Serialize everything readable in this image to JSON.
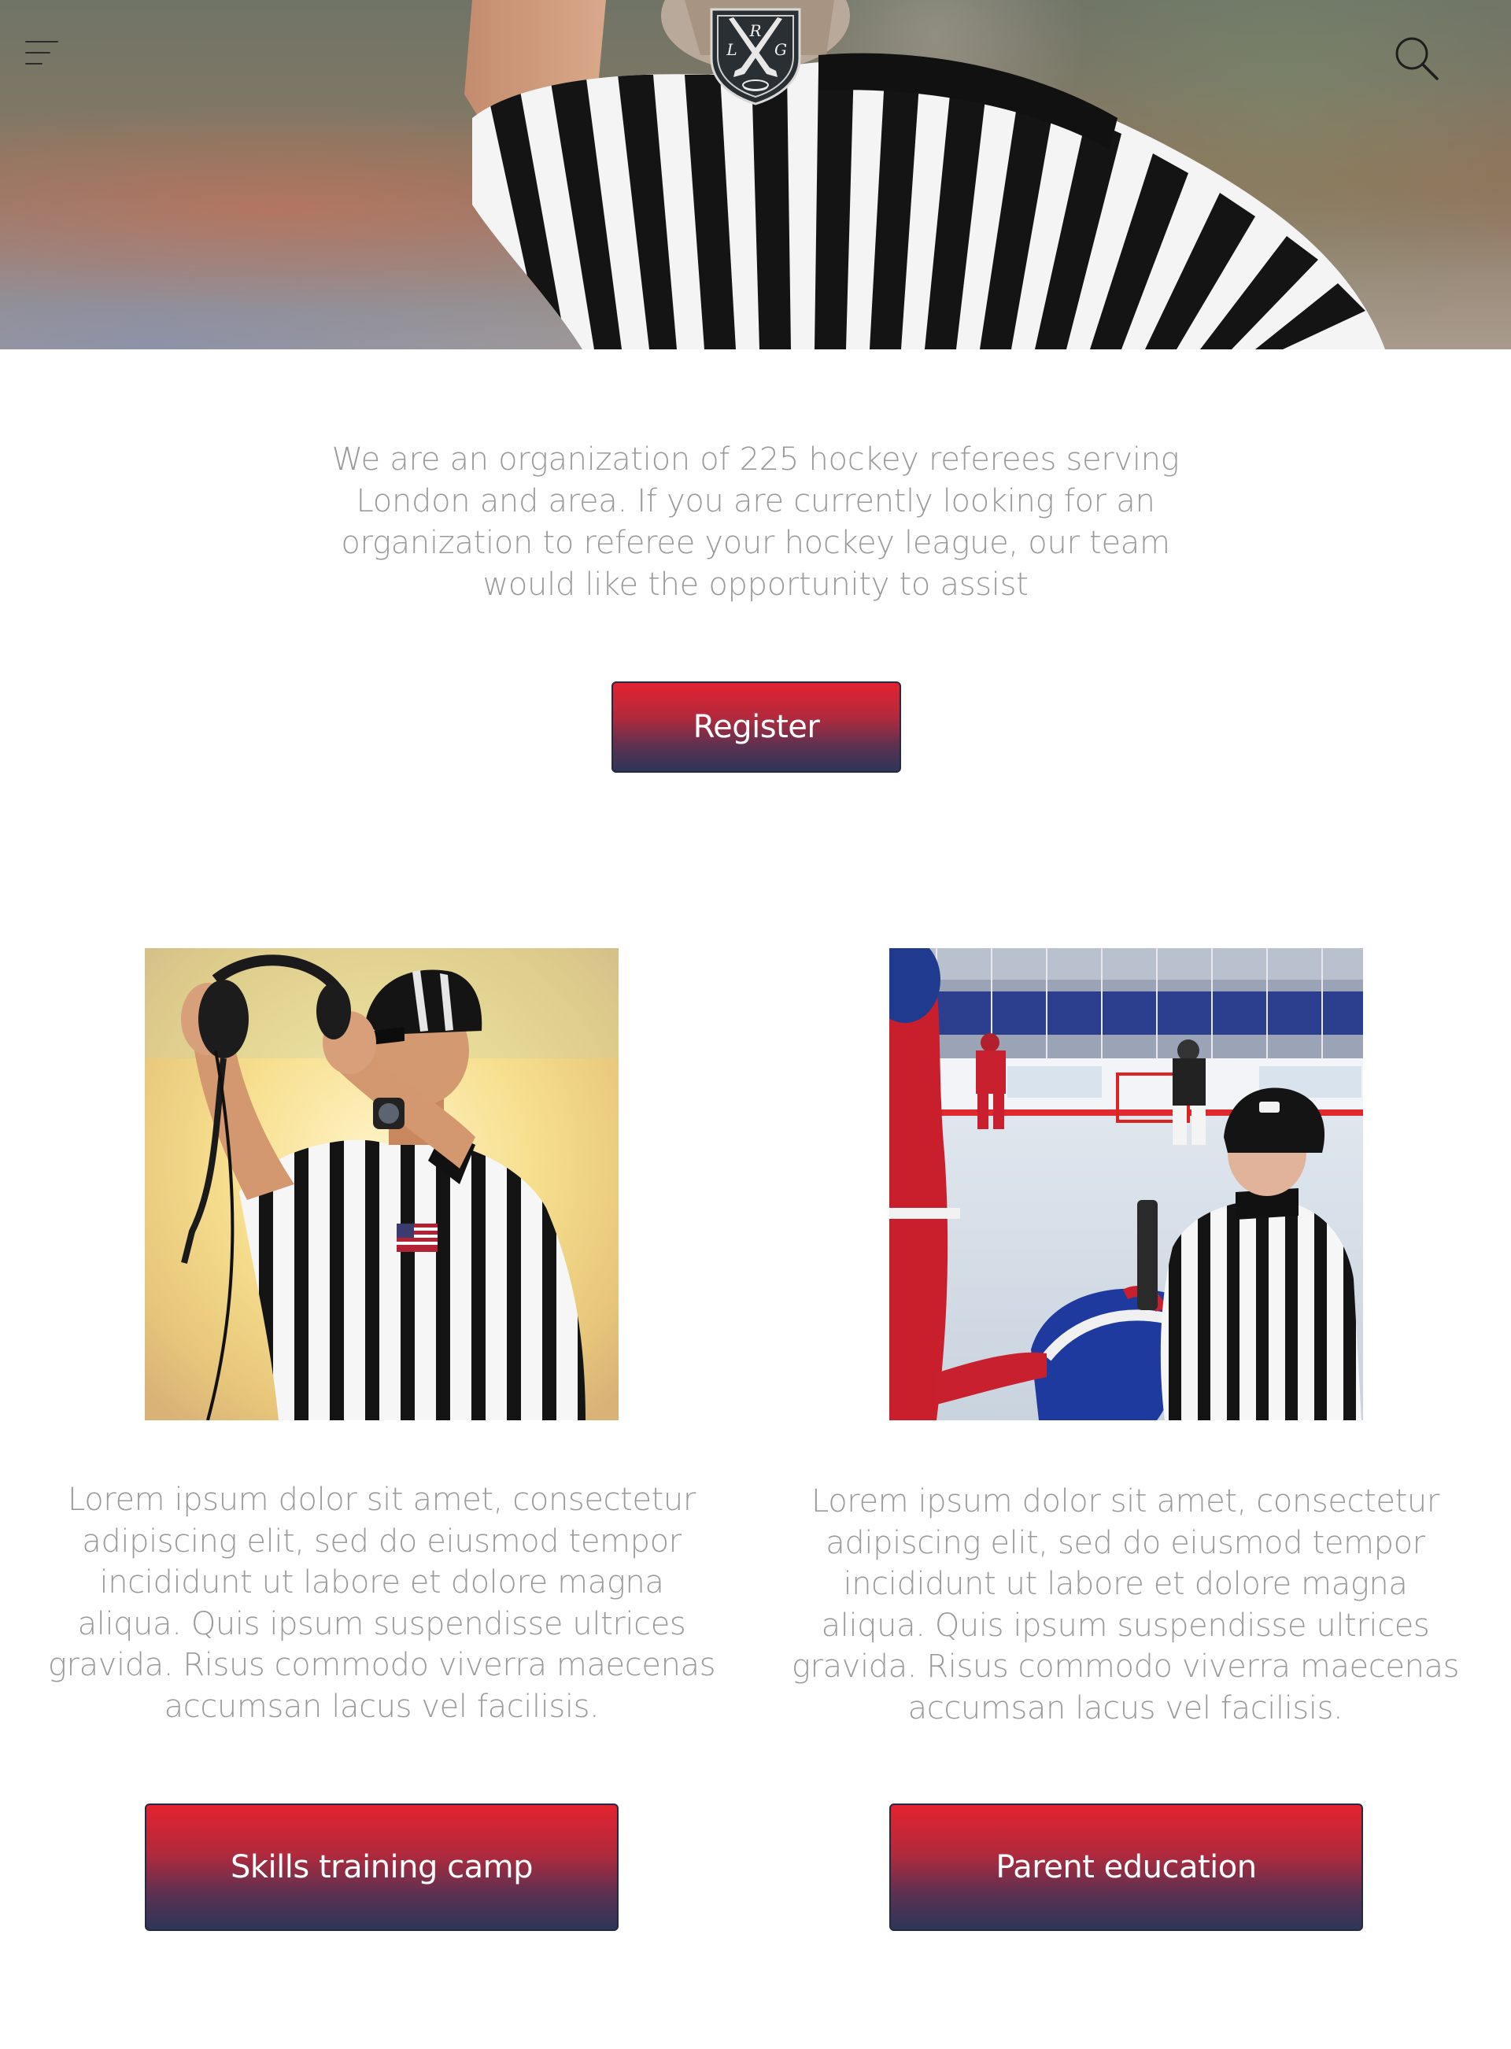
{
  "header": {
    "menu_icon": "hamburger-menu-icon",
    "logo": {
      "icon": "hockey-sticks-crest-logo",
      "letters": [
        "R",
        "L",
        "G"
      ]
    },
    "search_icon": "search-icon"
  },
  "intro": {
    "text": "We are an organization of 225 hockey referees serving London and area. If you are currently looking for an organization to referee your hockey league, our team would like the opportunity to assist",
    "register_label": "Register"
  },
  "cards": [
    {
      "image": "referee-removing-headset-photo",
      "text": "Lorem ipsum dolor sit amet, consectetur adipiscing elit, sed do eiusmod tempor incididunt ut labore et dolore magna aliqua. Quis ipsum suspendisse ultrices gravida. Risus commodo viverra maecenas accumsan lacus vel facilisis.",
      "button_label": "Skills training camp"
    },
    {
      "image": "referee-on-ice-rink-photo",
      "text": "Lorem ipsum dolor sit amet, consectetur adipiscing elit, sed do eiusmod tempor incididunt ut labore et dolore magna aliqua. Quis ipsum suspendisse ultrices gravida. Risus commodo viverra maecenas accumsan lacus vel facilisis.",
      "button_label": "Parent education"
    }
  ],
  "colors": {
    "button_top": "#e4222f",
    "button_bottom": "#2e3658",
    "button_border": "#242a3f",
    "body_text": "#9a9a9a"
  }
}
